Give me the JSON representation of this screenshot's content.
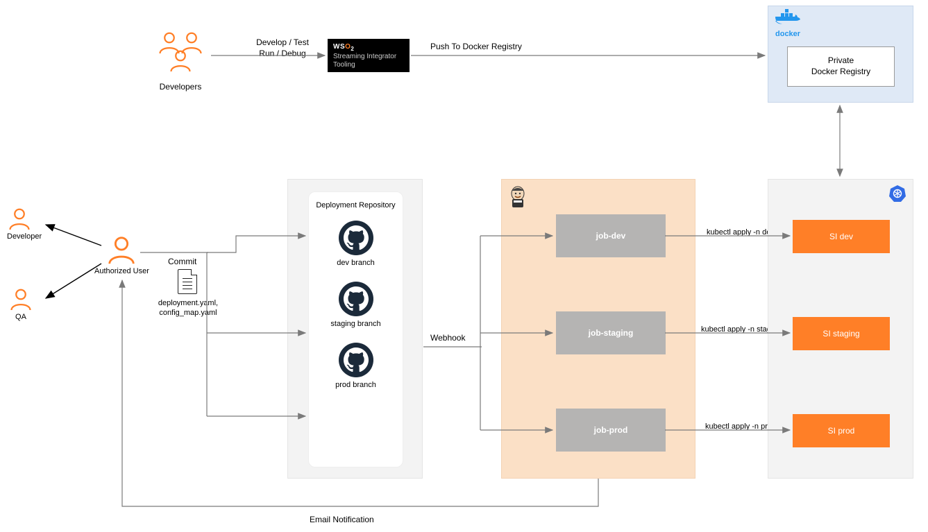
{
  "top": {
    "developers_label": "Developers",
    "develop_test_line1": "Develop / Test",
    "develop_test_line2": "Run / Debug",
    "wso2_brand_prefix": "WS",
    "wso2_brand_o": "O",
    "wso2_brand_suffix": "2",
    "wso2_line1": "Streaming Integrator",
    "wso2_line2": "Tooling",
    "push_label": "Push To Docker Registry",
    "docker_logo_label": "docker",
    "docker_registry_line1": "Private",
    "docker_registry_line2": "Docker Registry"
  },
  "left": {
    "developer_label": "Developer",
    "qa_label": "QA",
    "authorized_user_label": "Authorized User",
    "commit_label": "Commit",
    "file_line1": "deployment.yaml,",
    "file_line2": "config_map.yaml"
  },
  "repo": {
    "title": "Deployment Repository",
    "dev_branch": "dev branch",
    "staging_branch": "staging branch",
    "prod_branch": "prod branch"
  },
  "webhook_label": "Webhook",
  "jenkins": {
    "job_dev": "job-dev",
    "job_staging": "job-staging",
    "job_prod": "job-prod"
  },
  "kubectl": {
    "dev": "kubectl apply -n dev",
    "staging": "kubectl apply -n staging",
    "prod": "kubectl apply -n prod"
  },
  "k8s": {
    "si_dev": "SI dev",
    "si_staging": "SI staging",
    "si_prod": "SI prod"
  },
  "email_label": "Email Notification"
}
